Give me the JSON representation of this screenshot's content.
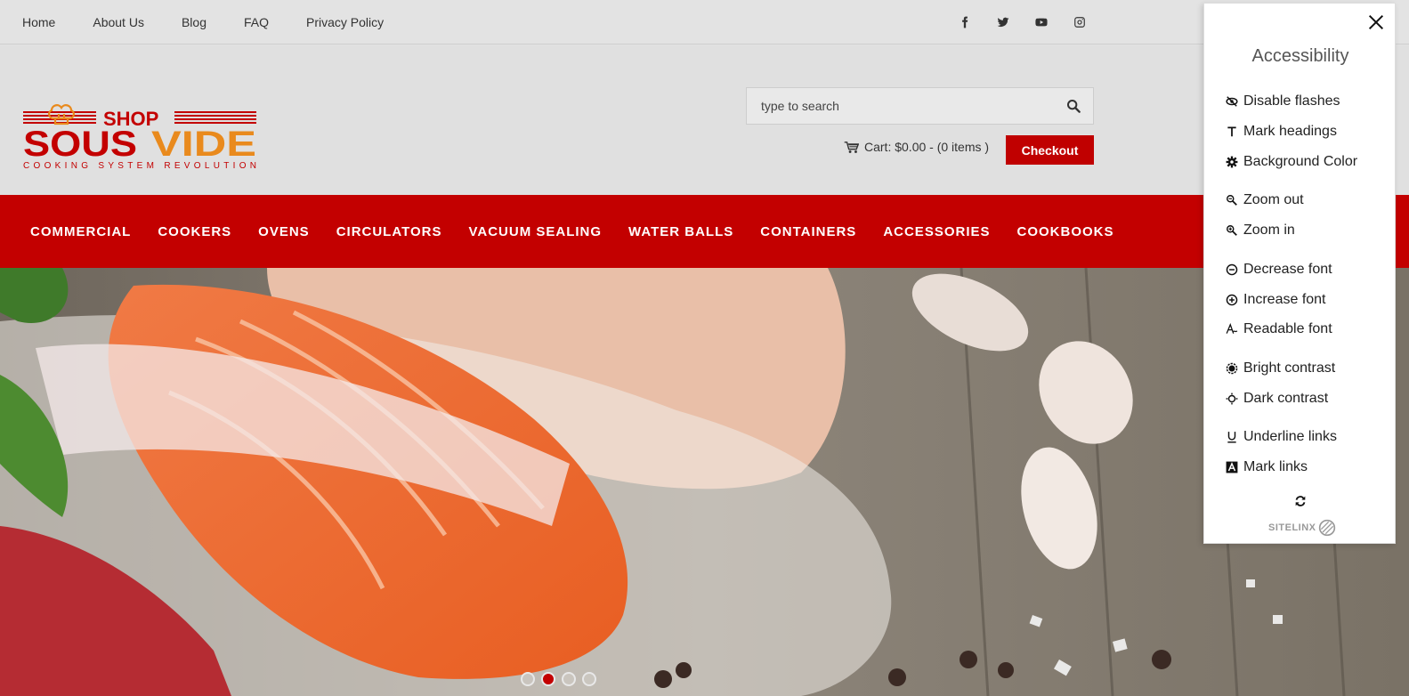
{
  "topnav": [
    "Home",
    "About Us",
    "Blog",
    "FAQ",
    "Privacy Policy"
  ],
  "social": [
    "facebook-icon",
    "twitter-icon",
    "youtube-icon",
    "instagram-icon"
  ],
  "logo": {
    "line1": "SHOP",
    "line2a": "SOUS",
    "line2b": "VIDE",
    "tagline": "COOKING SYSTEM REVOLUTION"
  },
  "search": {
    "placeholder": "type to search"
  },
  "cart": {
    "label": "Cart:",
    "amount": "$0.00",
    "items": "- (0 items )"
  },
  "checkout_label": "Checkout",
  "mainnav": [
    "COMMERCIAL",
    "COOKERS",
    "OVENS",
    "CIRCULATORS",
    "VACUUM SEALING",
    "WATER BALLS",
    "CONTAINERS",
    "ACCESSORIES",
    "COOKBOOKS"
  ],
  "slider": {
    "slides": 4,
    "active": 2
  },
  "accessibility": {
    "title": "Accessibility",
    "items": [
      {
        "label": "Disable flashes",
        "icon": "eye-slash-icon"
      },
      {
        "label": "Mark headings",
        "icon": "heading-icon"
      },
      {
        "label": "Background Color",
        "icon": "gear-icon"
      },
      {
        "label": "Zoom out",
        "icon": "zoom-out-icon"
      },
      {
        "label": "Zoom in",
        "icon": "zoom-in-icon"
      },
      {
        "label": "Decrease font",
        "icon": "minus-circle-icon"
      },
      {
        "label": "Increase font",
        "icon": "plus-circle-icon"
      },
      {
        "label": "Readable font",
        "icon": "readable-font-icon"
      },
      {
        "label": "Bright contrast",
        "icon": "bright-contrast-icon"
      },
      {
        "label": "Dark contrast",
        "icon": "dark-contrast-icon"
      },
      {
        "label": "Underline links",
        "icon": "underline-icon"
      },
      {
        "label": "Mark links",
        "icon": "mark-links-icon"
      }
    ],
    "brand": "SITELINX"
  },
  "colors": {
    "brand_red": "#c30000",
    "logo_orange": "#e98a1d"
  }
}
